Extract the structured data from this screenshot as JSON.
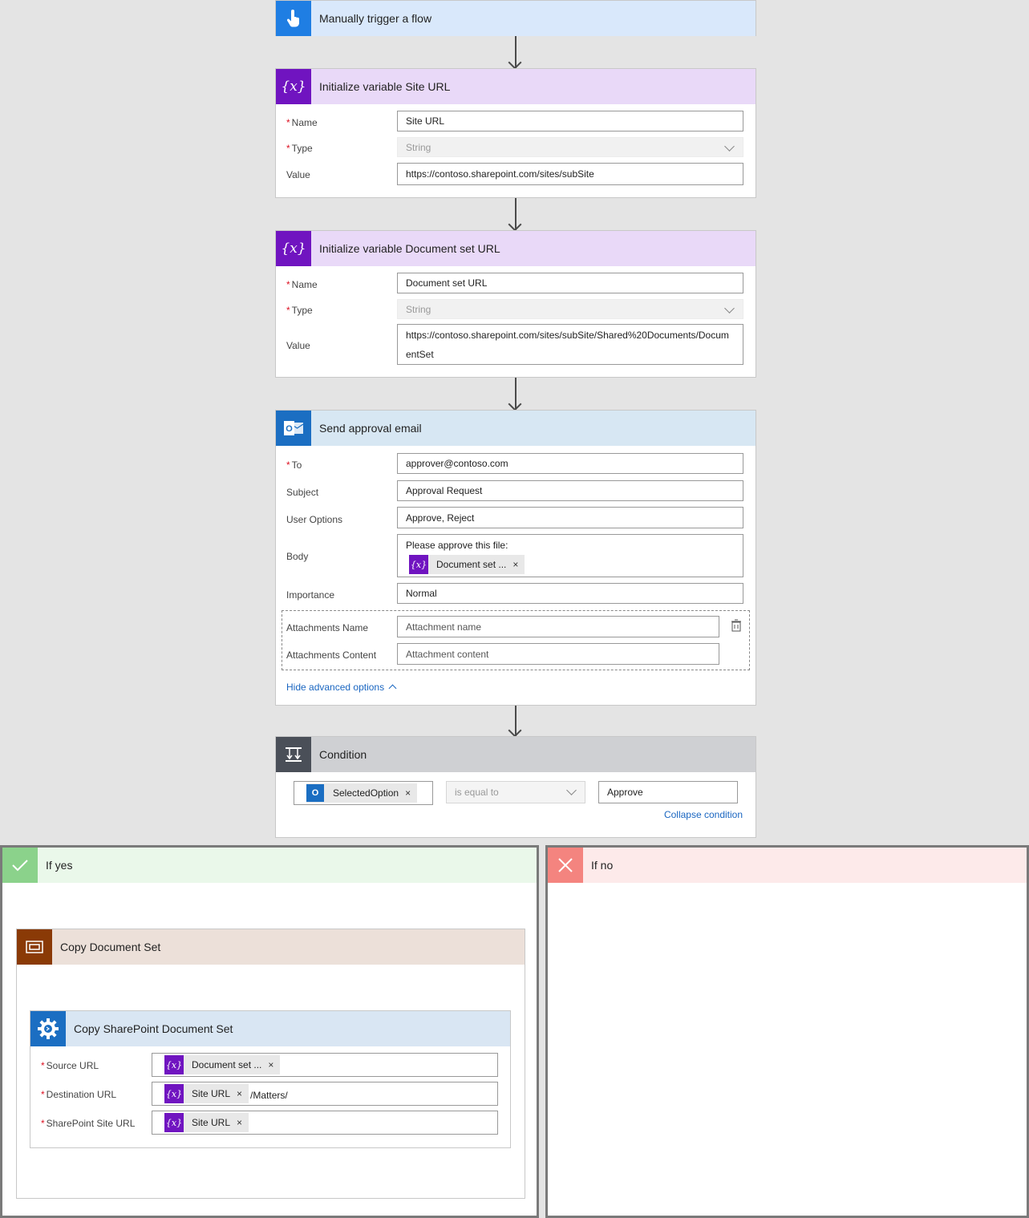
{
  "trigger": {
    "title": "Manually trigger a flow",
    "icon": "hand-tap-icon"
  },
  "var_site": {
    "title": "Initialize variable Site URL",
    "name_label": "Name",
    "name_value": "Site URL",
    "type_label": "Type",
    "type_value": "String",
    "value_label": "Value",
    "value_value": "https://contoso.sharepoint.com/sites/subSite"
  },
  "var_docset": {
    "title": "Initialize variable Document set URL",
    "name_label": "Name",
    "name_value": "Document set URL",
    "type_label": "Type",
    "type_value": "String",
    "value_label": "Value",
    "value_line1": "https://contoso.sharepoint.com/sites/subSite/Shared%20Documents/Docum",
    "value_line2": "entSet"
  },
  "email": {
    "title": "Send approval email",
    "to_label": "To",
    "to_value": "approver@contoso.com",
    "subject_label": "Subject",
    "subject_value": "Approval Request",
    "options_label": "User Options",
    "options_value": "Approve, Reject",
    "body_label": "Body",
    "body_text": "Please approve this file:",
    "body_token": "Document set ...",
    "importance_label": "Importance",
    "importance_value": "Normal",
    "att_name_label": "Attachments Name",
    "att_name_placeholder": "Attachment name",
    "att_content_label": "Attachments Content",
    "att_content_placeholder": "Attachment content",
    "hide_advanced": "Hide advanced options"
  },
  "condition": {
    "title": "Condition",
    "left_token": "SelectedOption",
    "operator": "is equal to",
    "right_value": "Approve",
    "collapse": "Collapse condition"
  },
  "if_yes": {
    "title": "If yes",
    "scope_title": "Copy Document Set",
    "action_title": "Copy SharePoint Document Set",
    "source_label": "Source URL",
    "source_token": "Document set ...",
    "dest_label": "Destination URL",
    "dest_token": "Site URL",
    "dest_suffix": "/Matters/",
    "site_label": "SharePoint Site URL",
    "site_token": "Site URL"
  },
  "if_no": {
    "title": "If no"
  },
  "colors": {
    "trigger": "#1f7ee3",
    "variable": "#7014c0",
    "outlook": "#1b6ec2",
    "condition": "#4a4f58",
    "yes": "#8bd28b",
    "no": "#f4847f",
    "scope": "#8a3a06",
    "link": "#1a66c1"
  }
}
